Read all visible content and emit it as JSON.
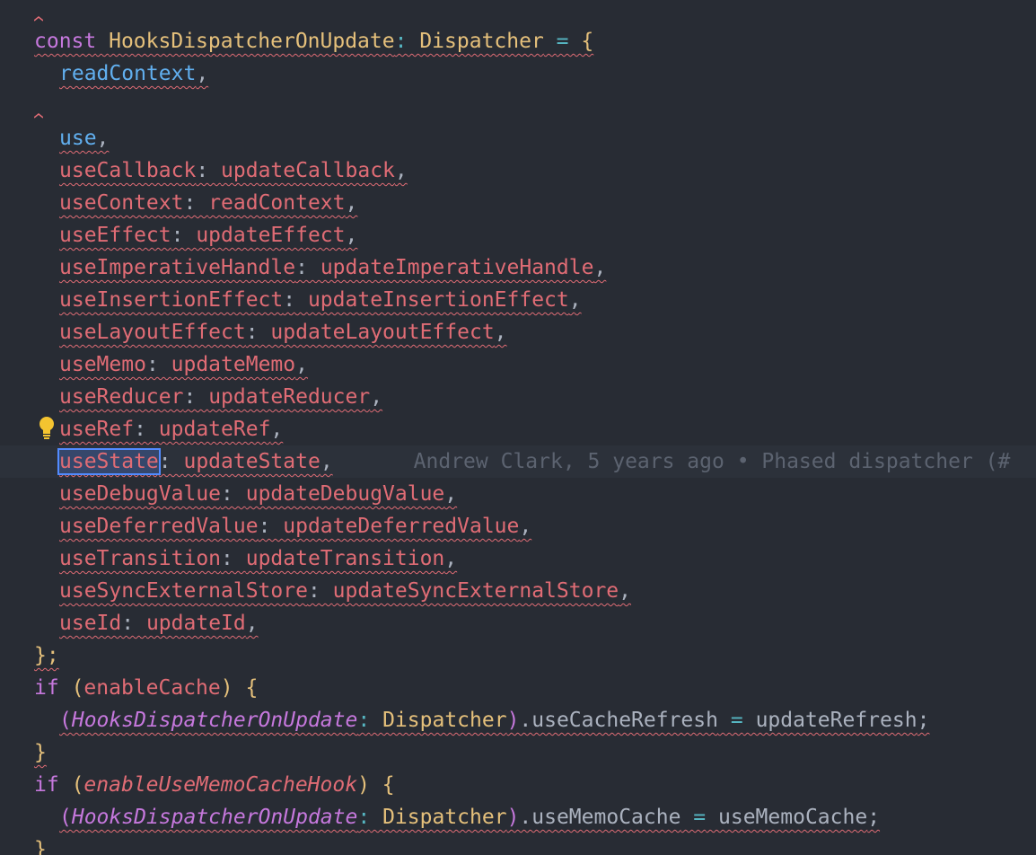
{
  "code": {
    "l1": {
      "kw": "const",
      "name": "HooksDispatcherOnUpdate",
      "colon": ":",
      "type": "Dispatcher",
      "eq": "=",
      "brace": "{"
    },
    "l2": {
      "name": "readContext",
      "comma": ","
    },
    "l4": {
      "name": "use",
      "comma": ","
    },
    "entries": [
      {
        "key": "useCallback",
        "value": "updateCallback"
      },
      {
        "key": "useContext",
        "value": "readContext"
      },
      {
        "key": "useEffect",
        "value": "updateEffect"
      },
      {
        "key": "useImperativeHandle",
        "value": "updateImperativeHandle"
      },
      {
        "key": "useInsertionEffect",
        "value": "updateInsertionEffect"
      },
      {
        "key": "useLayoutEffect",
        "value": "updateLayoutEffect"
      },
      {
        "key": "useMemo",
        "value": "updateMemo"
      },
      {
        "key": "useReducer",
        "value": "updateReducer"
      },
      {
        "key": "useRef",
        "value": "updateRef"
      },
      {
        "key": "useState",
        "value": "updateState"
      },
      {
        "key": "useDebugValue",
        "value": "updateDebugValue"
      },
      {
        "key": "useDeferredValue",
        "value": "updateDeferredValue"
      },
      {
        "key": "useTransition",
        "value": "updateTransition"
      },
      {
        "key": "useSyncExternalStore",
        "value": "updateSyncExternalStore"
      },
      {
        "key": "useId",
        "value": "updateId"
      }
    ],
    "close": "};",
    "if1": {
      "kw": "if",
      "open": "(",
      "cond": "enableCache",
      "close": ")",
      "brace": "{"
    },
    "if1_body": {
      "open": "(",
      "name": "HooksDispatcherOnUpdate",
      "colon": ":",
      "type": "Dispatcher",
      "close": ")",
      "member": ".useCacheRefresh",
      "eq": "=",
      "value": "updateRefresh",
      "semi": ";"
    },
    "if1_end": "}",
    "if2": {
      "kw": "if",
      "open": "(",
      "cond": "enableUseMemoCacheHook",
      "close": ")",
      "brace": "{"
    },
    "if2_body": {
      "open": "(",
      "name": "HooksDispatcherOnUpdate",
      "colon": ":",
      "type": "Dispatcher",
      "close": ")",
      "member": ".useMemoCache",
      "eq": "=",
      "value": "useMemoCache",
      "semi": ";"
    },
    "if2_end": "}"
  },
  "blame": "Andrew Clark, 5 years ago • Phased dispatcher (#",
  "icons": {
    "lightbulb": "lightbulb-icon"
  },
  "colors": {
    "background": "#282c34",
    "keyword": "#c678dd",
    "type": "#e5c07b",
    "property": "#e06c75",
    "function": "#61afef",
    "error_squiggle": "#e06c75",
    "blame": "#5c6370",
    "selection": "#528bff"
  }
}
